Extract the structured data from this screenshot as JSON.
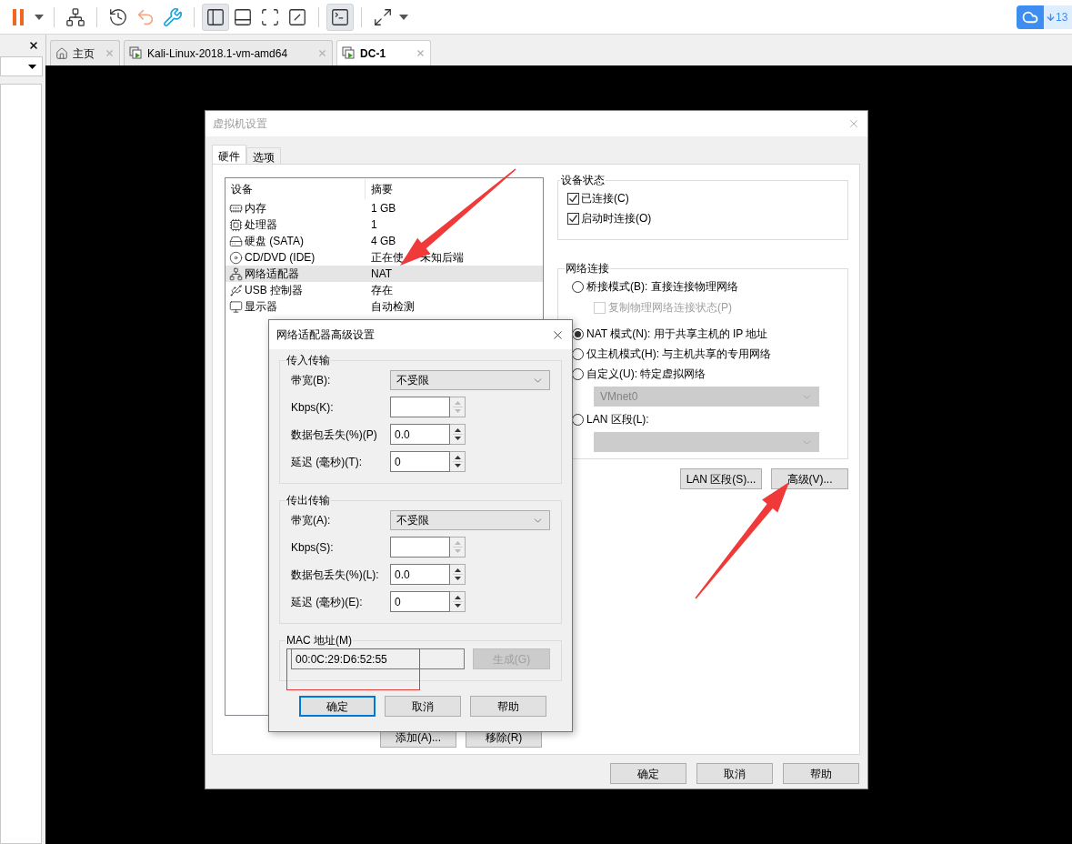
{
  "toolbar": {
    "items": [
      {
        "kind": "pause",
        "selected": false
      },
      {
        "kind": "caret",
        "selected": false
      },
      {
        "kind": "separator"
      },
      {
        "kind": "send",
        "selected": false
      },
      {
        "kind": "separator"
      },
      {
        "kind": "snapshot",
        "selected": false
      },
      {
        "kind": "revert",
        "selected": false
      },
      {
        "kind": "manage",
        "selected": false
      },
      {
        "kind": "separator"
      },
      {
        "kind": "sidebar",
        "selected": true
      },
      {
        "kind": "bottom",
        "selected": false
      },
      {
        "kind": "fit",
        "selected": false
      },
      {
        "kind": "unity",
        "selected": false
      },
      {
        "kind": "separator"
      },
      {
        "kind": "console",
        "selected": true
      },
      {
        "kind": "separator"
      },
      {
        "kind": "stretch",
        "selected": false
      },
      {
        "kind": "caret",
        "selected": false
      }
    ]
  },
  "notification": {
    "count": "13"
  },
  "tabs": [
    {
      "kind": "home",
      "label": "主页",
      "selected": false
    },
    {
      "kind": "vm",
      "label": "Kali-Linux-2018.1-vm-amd64",
      "selected": false
    },
    {
      "kind": "vm",
      "label": "DC-1",
      "selected": true
    }
  ],
  "settings_dialog": {
    "title": "虚拟机设置",
    "tabs": [
      {
        "label": "硬件",
        "selected": true
      },
      {
        "label": "选项",
        "selected": false
      }
    ],
    "columns": [
      "设备",
      "摘要"
    ],
    "devices": [
      {
        "kind": "memory",
        "name": "内存",
        "summary": "1 GB",
        "selected": false
      },
      {
        "kind": "cpu",
        "name": "处理器",
        "summary": "1",
        "selected": false
      },
      {
        "kind": "disk",
        "name": "硬盘 (SATA)",
        "summary": "4 GB",
        "selected": false
      },
      {
        "kind": "cd",
        "name": "CD/DVD (IDE)",
        "summary": "正在使",
        "summary_rest": "未知后端",
        "selected": false
      },
      {
        "kind": "network",
        "name": "网络适配器",
        "summary": "NAT",
        "selected": true
      },
      {
        "kind": "usb",
        "name": "USB 控制器",
        "summary": "存在",
        "selected": false
      },
      {
        "kind": "display",
        "name": "显示器",
        "summary": "自动检测",
        "selected": false
      }
    ],
    "list_buttons": [
      "添加(A)...",
      "移除(R)"
    ],
    "device_status": {
      "title": "设备状态",
      "options": [
        {
          "label": "已连接(C)",
          "checked": true
        },
        {
          "label": "启动时连接(O)",
          "checked": true
        }
      ]
    },
    "network_connection": {
      "title": "网络连接",
      "items": [
        {
          "kind": "radio",
          "label": "桥接模式(B): 直接连接物理网络",
          "selected": false
        },
        {
          "kind": "checkbox",
          "label": "复制物理网络连接状态(P)",
          "checked": false,
          "disabled": true
        },
        {
          "kind": "radio",
          "label": "NAT 模式(N): 用于共享主机的 IP 地址",
          "selected": true
        },
        {
          "kind": "radio",
          "label": "仅主机模式(H): 与主机共享的专用网络",
          "selected": false
        },
        {
          "kind": "radio",
          "label": "自定义(U): 特定虚拟网络",
          "selected": false
        },
        {
          "kind": "select",
          "value": "VMnet0",
          "disabled": true
        },
        {
          "kind": "radio",
          "label": "LAN 区段(L):",
          "selected": false
        },
        {
          "kind": "select",
          "disabled": true
        }
      ]
    },
    "network_buttons": [
      "LAN 区段(S)...",
      "高级(V)..."
    ],
    "buttons": [
      "确定",
      "取消",
      "帮助"
    ]
  },
  "advanced_dialog": {
    "title": "网络适配器高级设置",
    "groups": [
      {
        "title": "传入传输",
        "fields": [
          {
            "kind": "select",
            "label": "带宽(B):",
            "value": "不受限"
          },
          {
            "kind": "spin",
            "label": "Kbps(K):",
            "disabled": true
          },
          {
            "kind": "spin",
            "label": "数据包丢失(%)(P)",
            "value": "0.0",
            "disabled": false
          },
          {
            "kind": "spin",
            "label": "延迟 (毫秒)(T):",
            "value": "0",
            "disabled": false
          }
        ]
      },
      {
        "title": "传出传输",
        "fields": [
          {
            "kind": "select",
            "label": "带宽(A):",
            "value": "不受限"
          },
          {
            "kind": "spin",
            "label": "Kbps(S):",
            "disabled": true
          },
          {
            "kind": "spin",
            "label": "数据包丢失(%)(L):",
            "value": "0.0",
            "disabled": false
          },
          {
            "kind": "spin",
            "label": "延迟 (毫秒)(E):",
            "value": "0",
            "disabled": false
          }
        ]
      }
    ],
    "mac": {
      "label": "MAC 地址(M)",
      "value": "00:0C:29:D6:52:55",
      "button": "生成(G)",
      "button_disabled": true
    },
    "buttons": [
      {
        "label": "确定",
        "default": true
      },
      {
        "label": "取消",
        "default": false
      },
      {
        "label": "帮助",
        "default": false
      }
    ]
  }
}
